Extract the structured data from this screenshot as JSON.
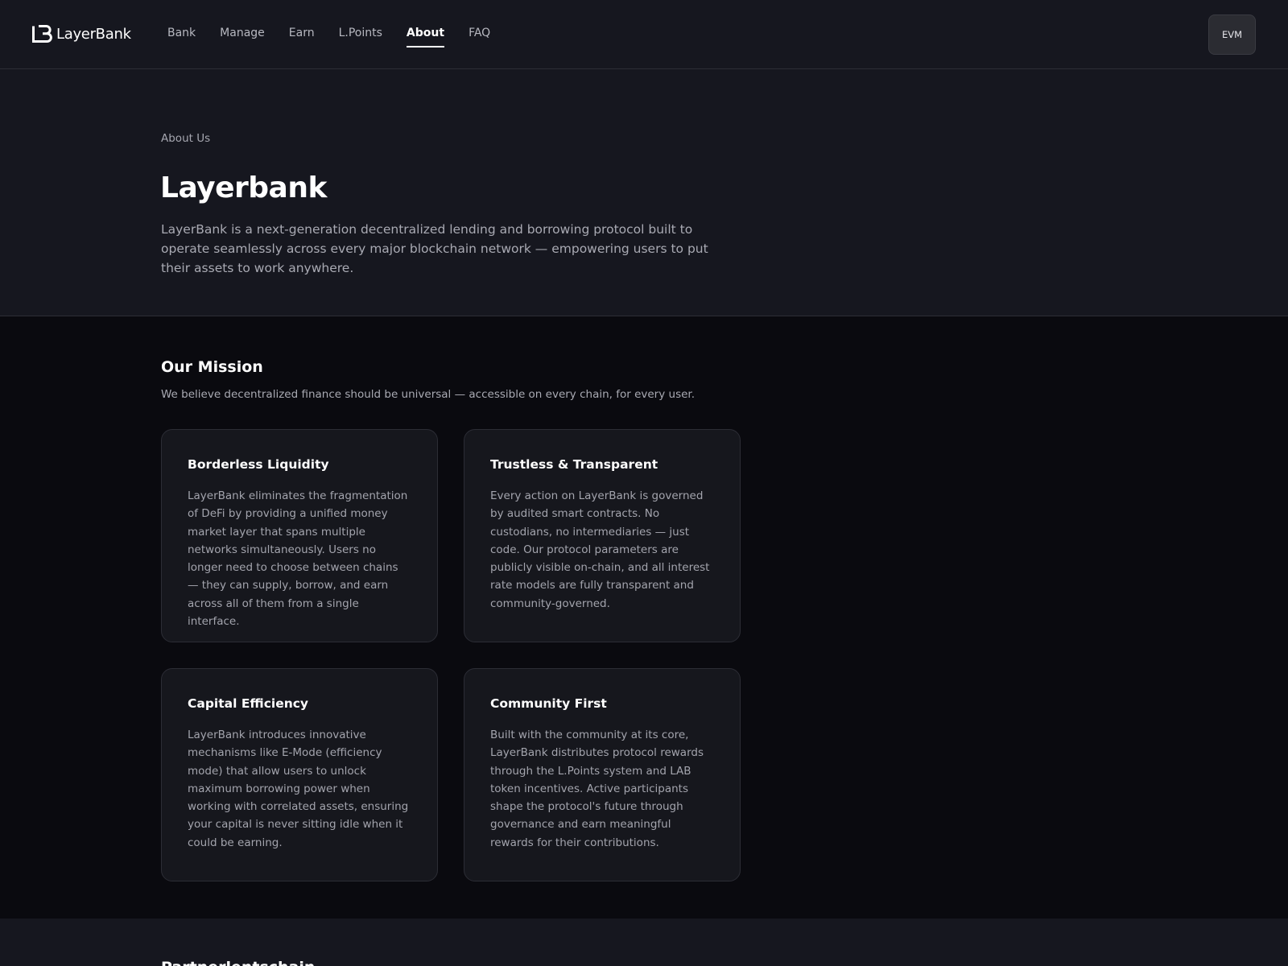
{
  "nav": {
    "logo_text": "LayerBank",
    "links": [
      {
        "label": "Bank"
      },
      {
        "label": "Manage"
      },
      {
        "label": "Earn"
      },
      {
        "label": "L.Points"
      },
      {
        "label": "About",
        "active": true
      },
      {
        "label": "FAQ"
      }
    ],
    "network_button": "EVM"
  },
  "hero": {
    "eyebrow": "About Us",
    "title": "Layerbank",
    "description": "LayerBank is a next-generation decentralized lending and borrowing protocol built to operate seamlessly across every major blockchain network — empowering users to put their assets to work anywhere."
  },
  "mission": {
    "title": "Our Mission",
    "subtitle": "We believe decentralized finance should be universal — accessible on every chain, for every user.",
    "cards": [
      {
        "title": "Borderless Liquidity",
        "body": "LayerBank eliminates the fragmentation of DeFi by providing a unified money market layer that spans multiple networks simultaneously. Users no longer need to choose between chains — they can supply, borrow, and earn across all of them from a single interface."
      },
      {
        "title": "Trustless & Transparent",
        "body": "Every action on LayerBank is governed by audited smart contracts. No custodians, no intermediaries — just code. Our protocol parameters are publicly visible on-chain, and all interest rate models are fully transparent and community-governed."
      },
      {
        "title": "Capital Efficiency",
        "body": "LayerBank introduces innovative mechanisms like E-Mode (efficiency mode) that allow users to unlock maximum borrowing power when working with correlated assets, ensuring your capital is never sitting idle when it could be earning."
      },
      {
        "title": "Community First",
        "body": "Built with the community at its core, LayerBank distributes protocol rewards through the L.Points system and LAB token incentives. Active participants shape the protocol's future through governance and earn meaningful rewards for their contributions."
      }
    ]
  },
  "next_section": {
    "title": "Partnerlentschain"
  },
  "colors": {
    "nav_bg": "#16171f",
    "page_bg": "#0a0a0f",
    "card_bg": "#16171d",
    "text_primary": "#ffffff",
    "text_muted": "#a9aab3"
  }
}
